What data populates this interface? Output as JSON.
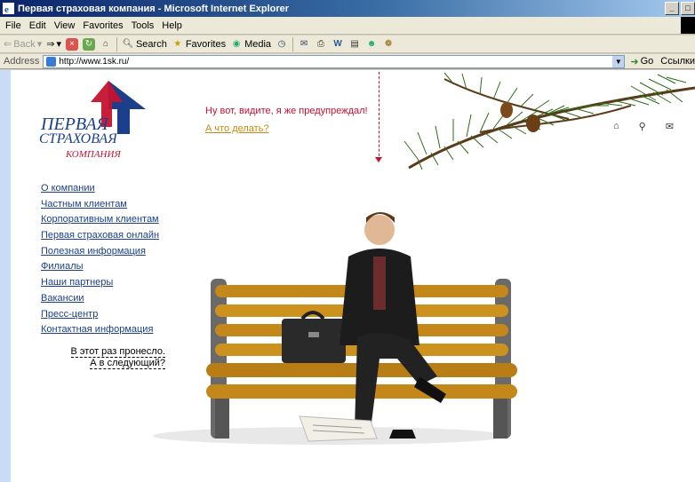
{
  "window": {
    "title": "Первая страховая компания - Microsoft Internet Explorer",
    "buttons": [
      "_",
      "□",
      "x"
    ]
  },
  "menu": [
    "File",
    "Edit",
    "View",
    "Favorites",
    "Tools",
    "Help"
  ],
  "toolbar": {
    "back": "Back",
    "search": "Search",
    "favorites": "Favorites",
    "media": "Media"
  },
  "address": {
    "label": "Address",
    "url": "http://www.1sk.ru/",
    "go": "Go",
    "links": "Ссылки"
  },
  "logo": {
    "line1": "ПЕРВАЯ",
    "line2": "СТРАХОВАЯ",
    "line3": "КОМПАНИЯ"
  },
  "tagline": "Ну вот, видите, я же предупреждал!",
  "tag_link": "А что делать?",
  "nav": [
    "О компании",
    "Частным клиентам",
    "Корпоративным клиентам",
    "Первая страховая онлайн",
    "Полезная информация",
    "Филиалы",
    "Наши партнеры",
    "Вакансии",
    "Пресс-центр",
    "Контактная информация"
  ],
  "quote": {
    "line1": "В этот раз пронесло.",
    "line2": "А в следующий?"
  },
  "colors": {
    "brand_red": "#c4122f",
    "brand_blue": "#1b3f8a",
    "link_gold": "#c48a14",
    "titlebar": "#0a246a"
  },
  "icons": [
    "home-icon",
    "search-icon",
    "mail-icon"
  ]
}
